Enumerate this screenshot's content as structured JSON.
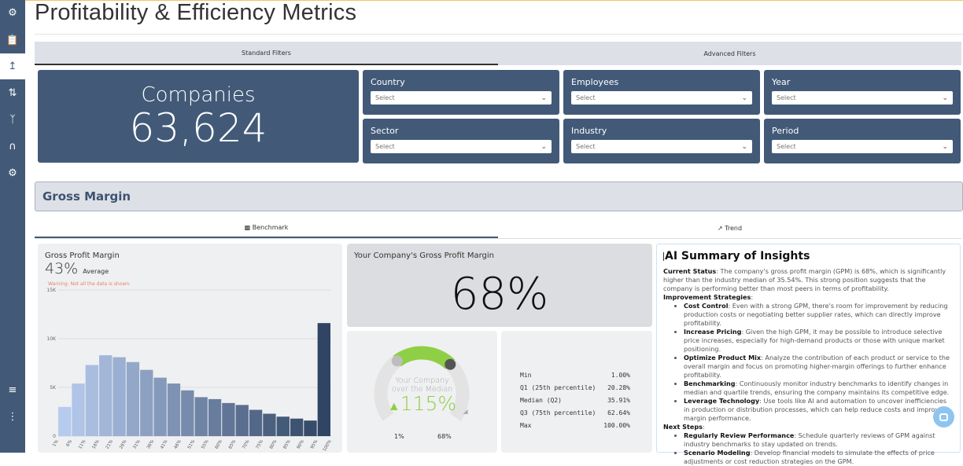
{
  "page": {
    "title": "Profitability & Efficiency Metrics"
  },
  "sidebar": {
    "icons": [
      "robot-icon",
      "clipboard-chart-icon",
      "line-chart-icon",
      "sliders-chart-icon",
      "network-icon",
      "bell-curve-icon",
      "gears-icon",
      "filter-settings-icon",
      "more-vertical-icon"
    ],
    "active": "line-chart-icon"
  },
  "filter_tabs": [
    {
      "label": "Standard Filters",
      "active": true
    },
    {
      "label": "Advanced Filters",
      "active": false
    }
  ],
  "companies": {
    "label": "Companies",
    "value": "63,624"
  },
  "filters": [
    {
      "label": "Country",
      "value": "Select"
    },
    {
      "label": "Employees",
      "value": "Select"
    },
    {
      "label": "Year",
      "value": "Select"
    },
    {
      "label": "Sector",
      "value": "Select"
    },
    {
      "label": "Industry",
      "value": "Select"
    },
    {
      "label": "Period",
      "value": "Select"
    }
  ],
  "section": {
    "title": "Gross Margin"
  },
  "view_tabs": [
    {
      "label": "Benchmark",
      "icon": "bar-chart-icon",
      "active": true
    },
    {
      "label": "Trend",
      "icon": "trend-icon",
      "active": false
    }
  ],
  "histogram": {
    "title": "Gross Profit Margin",
    "average": "43%",
    "average_label": "Average",
    "warning": "Warning: Not all the data is shown."
  },
  "chart_data": {
    "type": "bar",
    "ylim": [
      0,
      15000
    ],
    "yticks": [
      "0",
      "5K",
      "10K",
      "15K"
    ],
    "ytick_values": [
      0,
      5000,
      10000,
      15000
    ],
    "xticks": [
      "1%",
      "6%",
      "11%",
      "16%",
      "21%",
      "26%",
      "31%",
      "36%",
      "41%",
      "46%",
      "51%",
      "55%",
      "60%",
      "65%",
      "70%",
      "75%",
      "80%",
      "85%",
      "90%",
      "95%",
      "100%"
    ],
    "values": [
      3000,
      5400,
      7300,
      8300,
      8100,
      7600,
      6800,
      6000,
      5400,
      4700,
      4000,
      3800,
      3400,
      3200,
      2700,
      2300,
      2000,
      1800,
      1600,
      11600
    ],
    "colors": [
      "#b7cbee",
      "#2f4563"
    ],
    "grid": true
  },
  "company_gpm": {
    "title": "Your Company's Gross Profit Margin",
    "value": "68%"
  },
  "gauge": {
    "label_line1": "Your Company",
    "label_line2": "over the Median",
    "value": "115%",
    "min_label": "1%",
    "company_label": "68%",
    "min": 1,
    "max": 100,
    "median": 35.91,
    "company": 68,
    "color": "#8fcf45"
  },
  "stats": [
    {
      "label": "Min",
      "value": "1.00%"
    },
    {
      "label": "Q1 (25th percentile)",
      "value": "20.28%"
    },
    {
      "label": "Median (Q2)",
      "value": "35.91%"
    },
    {
      "label": "Q3 (75th percentile)",
      "value": "62.64%"
    },
    {
      "label": "Max",
      "value": "100.00%"
    }
  ],
  "ai": {
    "title": "AI Summary of Insights",
    "current_status_label": "Current Status",
    "current_status": ": The company's gross profit margin (GPM) is 68%, which is significantly higher than the industry median of 35.54%. This strong position suggests that the company is performing better than most peers in terms of profitability.",
    "improvement_label": "Improvement Strategies",
    "improvements": [
      {
        "b": "Cost Control",
        "t": ": Even with a strong GPM, there's room for improvement by reducing production costs or negotiating better supplier rates, which can directly improve profitability."
      },
      {
        "b": "Increase Pricing",
        "t": ": Given the high GPM, it may be possible to introduce selective price increases, especially for high-demand products or those with unique market positioning."
      },
      {
        "b": "Optimize Product Mix",
        "t": ": Analyze the contribution of each product or service to the overall margin and focus on promoting higher-margin offerings to further enhance profitability."
      },
      {
        "b": "Benchmarking",
        "t": ": Continuously monitor industry benchmarks to identify changes in median and quartile trends, ensuring the company maintains its competitive edge."
      },
      {
        "b": "Leverage Technology",
        "t": ": Use tools like AI and automation to uncover inefficiencies in production or distribution processes, which can help reduce costs and improve margin performance."
      }
    ],
    "next_label": "Next Steps",
    "next": [
      {
        "b": "Regularly Review Performance",
        "t": ": Schedule quarterly reviews of GPM against industry benchmarks to stay updated on trends."
      },
      {
        "b": "Scenario Modeling",
        "t": ": Develop financial models to simulate the effects of price adjustments or cost reduction strategies on the GPM."
      }
    ]
  }
}
